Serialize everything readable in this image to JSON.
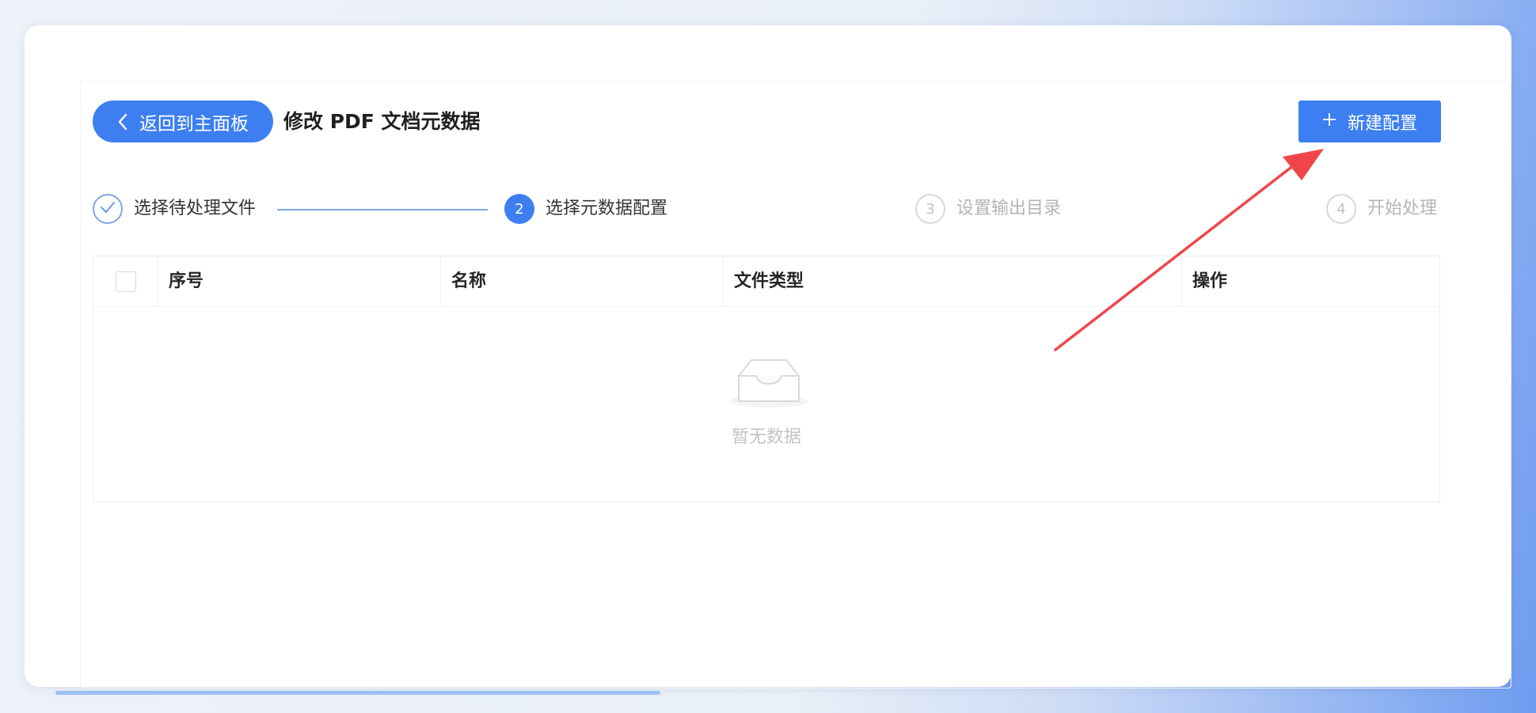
{
  "header": {
    "back_label": "返回到主面板",
    "title": "修改 PDF 文档元数据",
    "new_config_label": "新建配置"
  },
  "steps": [
    {
      "index": "1",
      "label": "选择待处理文件",
      "status": "done"
    },
    {
      "index": "2",
      "label": "选择元数据配置",
      "status": "active"
    },
    {
      "index": "3",
      "label": "设置输出目录",
      "status": "wait"
    },
    {
      "index": "4",
      "label": "开始处理",
      "status": "wait"
    }
  ],
  "table": {
    "columns": [
      "序号",
      "名称",
      "文件类型",
      "操作"
    ],
    "rows": [],
    "empty_text": "暂无数据"
  },
  "colors": {
    "accent": "#3d7ff0",
    "annotation_arrow": "#f0464b"
  },
  "icons": {
    "back": "chevron-left-icon",
    "add": "plus-icon",
    "done": "check-icon",
    "empty": "inbox-icon"
  }
}
